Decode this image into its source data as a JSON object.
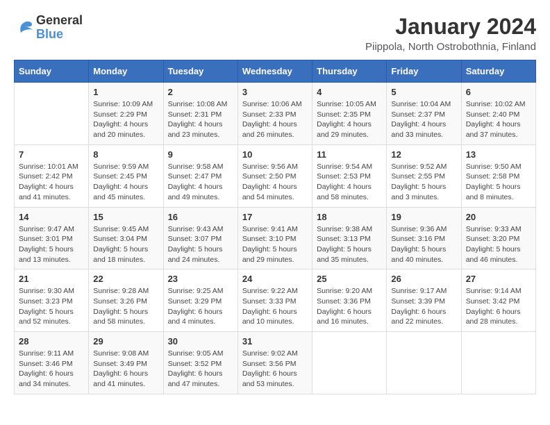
{
  "logo": {
    "general": "General",
    "blue": "Blue"
  },
  "title": "January 2024",
  "subtitle": "Piippola, North Ostrobothnia, Finland",
  "headers": [
    "Sunday",
    "Monday",
    "Tuesday",
    "Wednesday",
    "Thursday",
    "Friday",
    "Saturday"
  ],
  "weeks": [
    [
      {
        "day": "",
        "info": ""
      },
      {
        "day": "1",
        "info": "Sunrise: 10:09 AM\nSunset: 2:29 PM\nDaylight: 4 hours\nand 20 minutes."
      },
      {
        "day": "2",
        "info": "Sunrise: 10:08 AM\nSunset: 2:31 PM\nDaylight: 4 hours\nand 23 minutes."
      },
      {
        "day": "3",
        "info": "Sunrise: 10:06 AM\nSunset: 2:33 PM\nDaylight: 4 hours\nand 26 minutes."
      },
      {
        "day": "4",
        "info": "Sunrise: 10:05 AM\nSunset: 2:35 PM\nDaylight: 4 hours\nand 29 minutes."
      },
      {
        "day": "5",
        "info": "Sunrise: 10:04 AM\nSunset: 2:37 PM\nDaylight: 4 hours\nand 33 minutes."
      },
      {
        "day": "6",
        "info": "Sunrise: 10:02 AM\nSunset: 2:40 PM\nDaylight: 4 hours\nand 37 minutes."
      }
    ],
    [
      {
        "day": "7",
        "info": "Sunrise: 10:01 AM\nSunset: 2:42 PM\nDaylight: 4 hours\nand 41 minutes."
      },
      {
        "day": "8",
        "info": "Sunrise: 9:59 AM\nSunset: 2:45 PM\nDaylight: 4 hours\nand 45 minutes."
      },
      {
        "day": "9",
        "info": "Sunrise: 9:58 AM\nSunset: 2:47 PM\nDaylight: 4 hours\nand 49 minutes."
      },
      {
        "day": "10",
        "info": "Sunrise: 9:56 AM\nSunset: 2:50 PM\nDaylight: 4 hours\nand 54 minutes."
      },
      {
        "day": "11",
        "info": "Sunrise: 9:54 AM\nSunset: 2:53 PM\nDaylight: 4 hours\nand 58 minutes."
      },
      {
        "day": "12",
        "info": "Sunrise: 9:52 AM\nSunset: 2:55 PM\nDaylight: 5 hours\nand 3 minutes."
      },
      {
        "day": "13",
        "info": "Sunrise: 9:50 AM\nSunset: 2:58 PM\nDaylight: 5 hours\nand 8 minutes."
      }
    ],
    [
      {
        "day": "14",
        "info": "Sunrise: 9:47 AM\nSunset: 3:01 PM\nDaylight: 5 hours\nand 13 minutes."
      },
      {
        "day": "15",
        "info": "Sunrise: 9:45 AM\nSunset: 3:04 PM\nDaylight: 5 hours\nand 18 minutes."
      },
      {
        "day": "16",
        "info": "Sunrise: 9:43 AM\nSunset: 3:07 PM\nDaylight: 5 hours\nand 24 minutes."
      },
      {
        "day": "17",
        "info": "Sunrise: 9:41 AM\nSunset: 3:10 PM\nDaylight: 5 hours\nand 29 minutes."
      },
      {
        "day": "18",
        "info": "Sunrise: 9:38 AM\nSunset: 3:13 PM\nDaylight: 5 hours\nand 35 minutes."
      },
      {
        "day": "19",
        "info": "Sunrise: 9:36 AM\nSunset: 3:16 PM\nDaylight: 5 hours\nand 40 minutes."
      },
      {
        "day": "20",
        "info": "Sunrise: 9:33 AM\nSunset: 3:20 PM\nDaylight: 5 hours\nand 46 minutes."
      }
    ],
    [
      {
        "day": "21",
        "info": "Sunrise: 9:30 AM\nSunset: 3:23 PM\nDaylight: 5 hours\nand 52 minutes."
      },
      {
        "day": "22",
        "info": "Sunrise: 9:28 AM\nSunset: 3:26 PM\nDaylight: 5 hours\nand 58 minutes."
      },
      {
        "day": "23",
        "info": "Sunrise: 9:25 AM\nSunset: 3:29 PM\nDaylight: 6 hours\nand 4 minutes."
      },
      {
        "day": "24",
        "info": "Sunrise: 9:22 AM\nSunset: 3:33 PM\nDaylight: 6 hours\nand 10 minutes."
      },
      {
        "day": "25",
        "info": "Sunrise: 9:20 AM\nSunset: 3:36 PM\nDaylight: 6 hours\nand 16 minutes."
      },
      {
        "day": "26",
        "info": "Sunrise: 9:17 AM\nSunset: 3:39 PM\nDaylight: 6 hours\nand 22 minutes."
      },
      {
        "day": "27",
        "info": "Sunrise: 9:14 AM\nSunset: 3:42 PM\nDaylight: 6 hours\nand 28 minutes."
      }
    ],
    [
      {
        "day": "28",
        "info": "Sunrise: 9:11 AM\nSunset: 3:46 PM\nDaylight: 6 hours\nand 34 minutes."
      },
      {
        "day": "29",
        "info": "Sunrise: 9:08 AM\nSunset: 3:49 PM\nDaylight: 6 hours\nand 41 minutes."
      },
      {
        "day": "30",
        "info": "Sunrise: 9:05 AM\nSunset: 3:52 PM\nDaylight: 6 hours\nand 47 minutes."
      },
      {
        "day": "31",
        "info": "Sunrise: 9:02 AM\nSunset: 3:56 PM\nDaylight: 6 hours\nand 53 minutes."
      },
      {
        "day": "",
        "info": ""
      },
      {
        "day": "",
        "info": ""
      },
      {
        "day": "",
        "info": ""
      }
    ]
  ]
}
